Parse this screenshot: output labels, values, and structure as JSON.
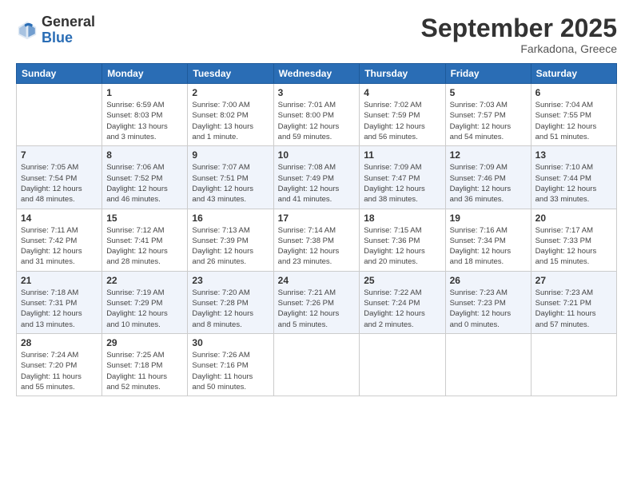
{
  "logo": {
    "general": "General",
    "blue": "Blue"
  },
  "header": {
    "month": "September 2025",
    "location": "Farkadona, Greece"
  },
  "days_of_week": [
    "Sunday",
    "Monday",
    "Tuesday",
    "Wednesday",
    "Thursday",
    "Friday",
    "Saturday"
  ],
  "weeks": [
    [
      {
        "day": "",
        "info": ""
      },
      {
        "day": "1",
        "info": "Sunrise: 6:59 AM\nSunset: 8:03 PM\nDaylight: 13 hours\nand 3 minutes."
      },
      {
        "day": "2",
        "info": "Sunrise: 7:00 AM\nSunset: 8:02 PM\nDaylight: 13 hours\nand 1 minute."
      },
      {
        "day": "3",
        "info": "Sunrise: 7:01 AM\nSunset: 8:00 PM\nDaylight: 12 hours\nand 59 minutes."
      },
      {
        "day": "4",
        "info": "Sunrise: 7:02 AM\nSunset: 7:59 PM\nDaylight: 12 hours\nand 56 minutes."
      },
      {
        "day": "5",
        "info": "Sunrise: 7:03 AM\nSunset: 7:57 PM\nDaylight: 12 hours\nand 54 minutes."
      },
      {
        "day": "6",
        "info": "Sunrise: 7:04 AM\nSunset: 7:55 PM\nDaylight: 12 hours\nand 51 minutes."
      }
    ],
    [
      {
        "day": "7",
        "info": "Sunrise: 7:05 AM\nSunset: 7:54 PM\nDaylight: 12 hours\nand 48 minutes."
      },
      {
        "day": "8",
        "info": "Sunrise: 7:06 AM\nSunset: 7:52 PM\nDaylight: 12 hours\nand 46 minutes."
      },
      {
        "day": "9",
        "info": "Sunrise: 7:07 AM\nSunset: 7:51 PM\nDaylight: 12 hours\nand 43 minutes."
      },
      {
        "day": "10",
        "info": "Sunrise: 7:08 AM\nSunset: 7:49 PM\nDaylight: 12 hours\nand 41 minutes."
      },
      {
        "day": "11",
        "info": "Sunrise: 7:09 AM\nSunset: 7:47 PM\nDaylight: 12 hours\nand 38 minutes."
      },
      {
        "day": "12",
        "info": "Sunrise: 7:09 AM\nSunset: 7:46 PM\nDaylight: 12 hours\nand 36 minutes."
      },
      {
        "day": "13",
        "info": "Sunrise: 7:10 AM\nSunset: 7:44 PM\nDaylight: 12 hours\nand 33 minutes."
      }
    ],
    [
      {
        "day": "14",
        "info": "Sunrise: 7:11 AM\nSunset: 7:42 PM\nDaylight: 12 hours\nand 31 minutes."
      },
      {
        "day": "15",
        "info": "Sunrise: 7:12 AM\nSunset: 7:41 PM\nDaylight: 12 hours\nand 28 minutes."
      },
      {
        "day": "16",
        "info": "Sunrise: 7:13 AM\nSunset: 7:39 PM\nDaylight: 12 hours\nand 26 minutes."
      },
      {
        "day": "17",
        "info": "Sunrise: 7:14 AM\nSunset: 7:38 PM\nDaylight: 12 hours\nand 23 minutes."
      },
      {
        "day": "18",
        "info": "Sunrise: 7:15 AM\nSunset: 7:36 PM\nDaylight: 12 hours\nand 20 minutes."
      },
      {
        "day": "19",
        "info": "Sunrise: 7:16 AM\nSunset: 7:34 PM\nDaylight: 12 hours\nand 18 minutes."
      },
      {
        "day": "20",
        "info": "Sunrise: 7:17 AM\nSunset: 7:33 PM\nDaylight: 12 hours\nand 15 minutes."
      }
    ],
    [
      {
        "day": "21",
        "info": "Sunrise: 7:18 AM\nSunset: 7:31 PM\nDaylight: 12 hours\nand 13 minutes."
      },
      {
        "day": "22",
        "info": "Sunrise: 7:19 AM\nSunset: 7:29 PM\nDaylight: 12 hours\nand 10 minutes."
      },
      {
        "day": "23",
        "info": "Sunrise: 7:20 AM\nSunset: 7:28 PM\nDaylight: 12 hours\nand 8 minutes."
      },
      {
        "day": "24",
        "info": "Sunrise: 7:21 AM\nSunset: 7:26 PM\nDaylight: 12 hours\nand 5 minutes."
      },
      {
        "day": "25",
        "info": "Sunrise: 7:22 AM\nSunset: 7:24 PM\nDaylight: 12 hours\nand 2 minutes."
      },
      {
        "day": "26",
        "info": "Sunrise: 7:23 AM\nSunset: 7:23 PM\nDaylight: 12 hours\nand 0 minutes."
      },
      {
        "day": "27",
        "info": "Sunrise: 7:23 AM\nSunset: 7:21 PM\nDaylight: 11 hours\nand 57 minutes."
      }
    ],
    [
      {
        "day": "28",
        "info": "Sunrise: 7:24 AM\nSunset: 7:20 PM\nDaylight: 11 hours\nand 55 minutes."
      },
      {
        "day": "29",
        "info": "Sunrise: 7:25 AM\nSunset: 7:18 PM\nDaylight: 11 hours\nand 52 minutes."
      },
      {
        "day": "30",
        "info": "Sunrise: 7:26 AM\nSunset: 7:16 PM\nDaylight: 11 hours\nand 50 minutes."
      },
      {
        "day": "",
        "info": ""
      },
      {
        "day": "",
        "info": ""
      },
      {
        "day": "",
        "info": ""
      },
      {
        "day": "",
        "info": ""
      }
    ]
  ]
}
